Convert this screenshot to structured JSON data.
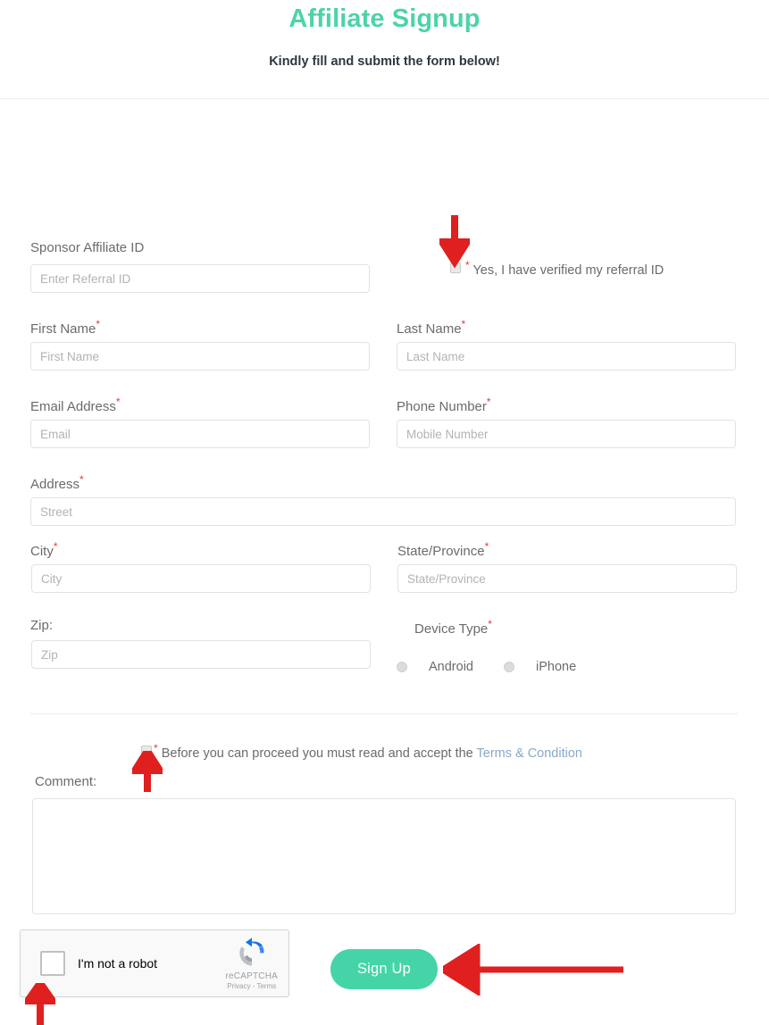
{
  "header": {
    "title": "Affiliate Signup",
    "subtitle": "Kindly fill and submit the form below!",
    "title_color": "#4cd3a9"
  },
  "form": {
    "required_marker": "*",
    "fields": {
      "sponsor_id": {
        "label": "Sponsor Affiliate ID",
        "placeholder": "Enter Referral ID",
        "value": "",
        "required": false
      },
      "first_name": {
        "label": "First Name",
        "placeholder": "First Name",
        "value": "",
        "required": true
      },
      "last_name": {
        "label": "Last Name",
        "placeholder": "Last Name",
        "value": "",
        "required": true
      },
      "email": {
        "label": "Email Address",
        "placeholder": "Email",
        "value": "",
        "required": true
      },
      "phone": {
        "label": "Phone Number",
        "placeholder": "Mobile Number",
        "value": "",
        "required": true
      },
      "address": {
        "label": "Address",
        "placeholder": "Street",
        "value": "",
        "required": true
      },
      "city": {
        "label": "City",
        "placeholder": "City",
        "value": "",
        "required": true
      },
      "state": {
        "label": "State/Province",
        "placeholder": "State/Province",
        "value": "",
        "required": true
      },
      "zip": {
        "label": "Zip:",
        "placeholder": "Zip",
        "value": "",
        "required": false
      },
      "comment": {
        "label": "Comment:",
        "placeholder": "",
        "value": ""
      }
    },
    "verify_checkbox": {
      "marker": "*",
      "label": "Yes, I have verified my referral ID",
      "checked": false
    },
    "device_type": {
      "label": "Device Type",
      "required": true,
      "options": [
        {
          "label": "Android",
          "selected": false
        },
        {
          "label": "iPhone",
          "selected": false
        }
      ]
    },
    "terms_checkbox": {
      "marker": "*",
      "text_before": "Before you can proceed you must read and accept the ",
      "link_label": "Terms & Condition",
      "link_color": "#88a9c9",
      "checked": false
    },
    "recaptcha": {
      "label": "I'm not a robot",
      "brand": "reCAPTCHA",
      "legal": "Privacy - Terms",
      "checked": false
    },
    "submit": {
      "label": "Sign Up",
      "color": "#45d4a8"
    }
  },
  "annotations": {
    "arrow_color": "#e01f1f",
    "arrows": [
      {
        "name": "arrow-to-verify-checkbox",
        "direction": "down"
      },
      {
        "name": "arrow-to-terms-checkbox",
        "direction": "up"
      },
      {
        "name": "arrow-to-recaptcha",
        "direction": "up"
      },
      {
        "name": "arrow-to-signup-button",
        "direction": "left"
      }
    ]
  }
}
